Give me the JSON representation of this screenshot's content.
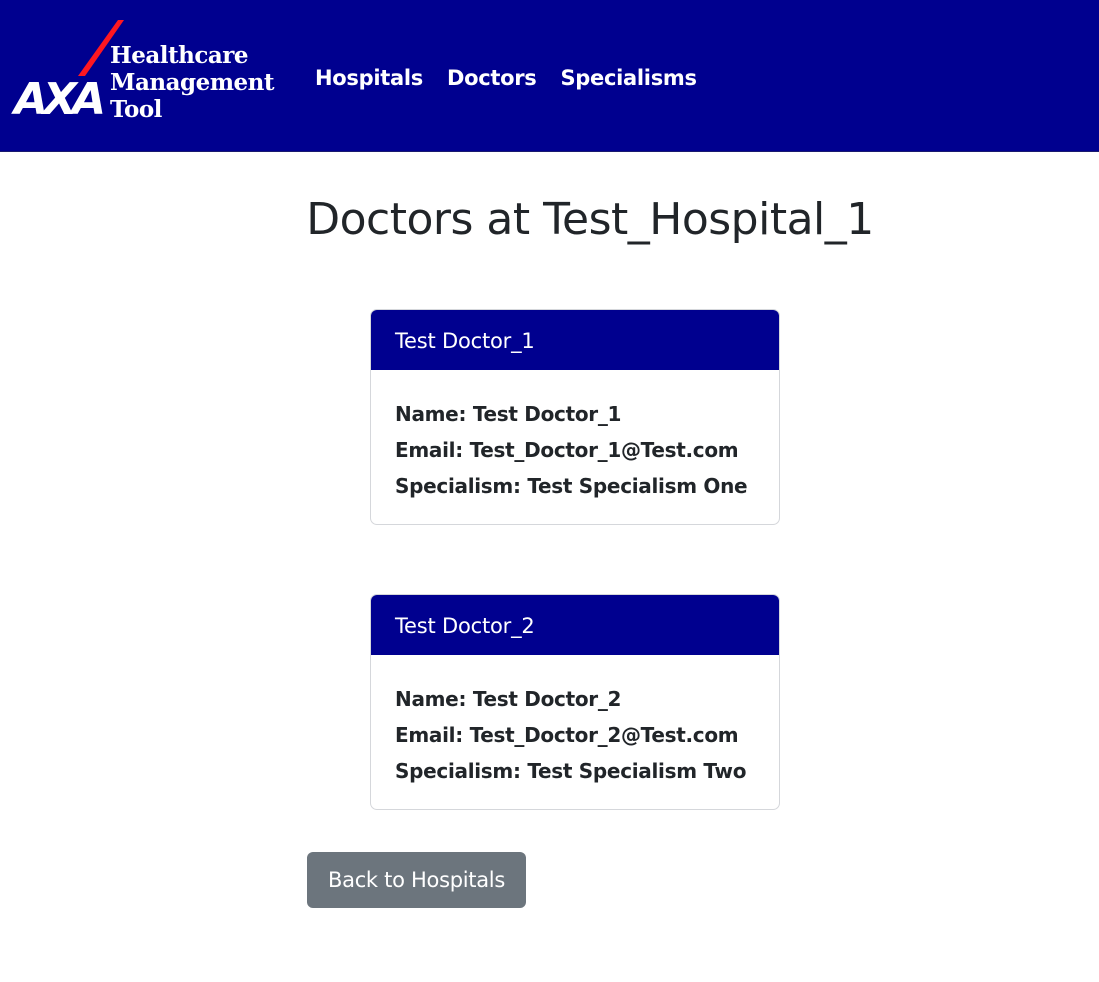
{
  "navbar": {
    "logo": {
      "brand": "AXA",
      "line1": "Healthcare",
      "line2": "Management",
      "line3": "Tool"
    },
    "links": [
      "Hospitals",
      "Doctors",
      "Specialisms"
    ]
  },
  "main": {
    "title": "Doctors at Test_Hospital_1",
    "name_label": "Name:",
    "email_label": "Email:",
    "specialism_label": "Specialism:",
    "doctors": [
      {
        "header": "Test Doctor_1",
        "name": "Test Doctor_1",
        "email": "Test_Doctor_1@Test.com",
        "specialism": "Test Specialism One"
      },
      {
        "header": "Test Doctor_2",
        "name": "Test Doctor_2",
        "email": "Test_Doctor_2@Test.com",
        "specialism": "Test Specialism Two"
      }
    ],
    "back_button": "Back to Hospitals"
  },
  "colors": {
    "brand_navy": "#00008f",
    "brand_red": "#ff1721",
    "secondary_button": "#6c757d"
  }
}
